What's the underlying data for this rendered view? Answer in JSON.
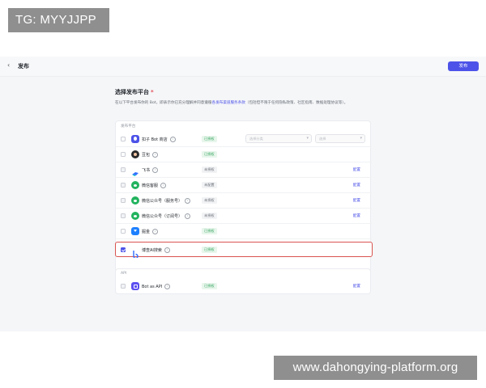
{
  "watermarks": {
    "top_left": "TG: MYYJJPP",
    "bottom_right": "www.dahongying-platform.org"
  },
  "header": {
    "back_icon": "chevron-left-icon",
    "title": "发布",
    "publish_label": "发布"
  },
  "section": {
    "title": "选择发布平台",
    "required_mark": "*",
    "desc_prefix": "在以下平台发布你的 Bot，即表示你已充分理解并同意遵循",
    "desc_link": "各发布渠道服务条款",
    "desc_suffix": "（包括但不限于任何隐私政策、社区指南、数据处理协议等）。"
  },
  "platforms_header": "发布平台",
  "platforms": [
    {
      "name": "扣子 Bot 商店",
      "icon": "coze-icon",
      "status": "已授权",
      "status_type": "ok",
      "checked": false,
      "disabled": false,
      "config": "",
      "select1": "选择分类",
      "select1_val": "",
      "select2": "选择",
      "select2_val": ""
    },
    {
      "name": "豆包",
      "icon": "doudou-icon",
      "status": "已授权",
      "status_type": "ok",
      "checked": false,
      "disabled": false,
      "config": ""
    },
    {
      "name": "飞书",
      "icon": "feishu-icon",
      "status": "未授权",
      "status_type": "no",
      "checked": false,
      "disabled": true,
      "config": "配置"
    },
    {
      "name": "微信客服",
      "icon": "wechat-icon",
      "status": "未配置",
      "status_type": "no",
      "checked": false,
      "disabled": true,
      "config": "配置"
    },
    {
      "name": "微信公众号（服务号）",
      "icon": "wechat-icon",
      "status": "未授权",
      "status_type": "no",
      "checked": false,
      "disabled": true,
      "config": "配置"
    },
    {
      "name": "微信公众号（订阅号）",
      "icon": "wechat-icon",
      "status": "未授权",
      "status_type": "no",
      "checked": false,
      "disabled": true,
      "config": "配置"
    },
    {
      "name": "掘金",
      "icon": "juejin-icon",
      "status": "已授权",
      "status_type": "ok",
      "checked": false,
      "disabled": false,
      "config": ""
    },
    {
      "name": "博查AI搜索",
      "icon": "bocha-icon",
      "status": "已授权",
      "status_type": "ok",
      "checked": true,
      "disabled": false,
      "config": ""
    }
  ],
  "api_header": "API",
  "api": {
    "name": "Bot as API",
    "icon": "api-icon",
    "status": "已授权",
    "status_type": "ok",
    "checked": false,
    "config": "配置"
  },
  "colors": {
    "accent": "#4d53e8",
    "ok_green": "#2fa25a",
    "selected_border": "#d9534f"
  }
}
